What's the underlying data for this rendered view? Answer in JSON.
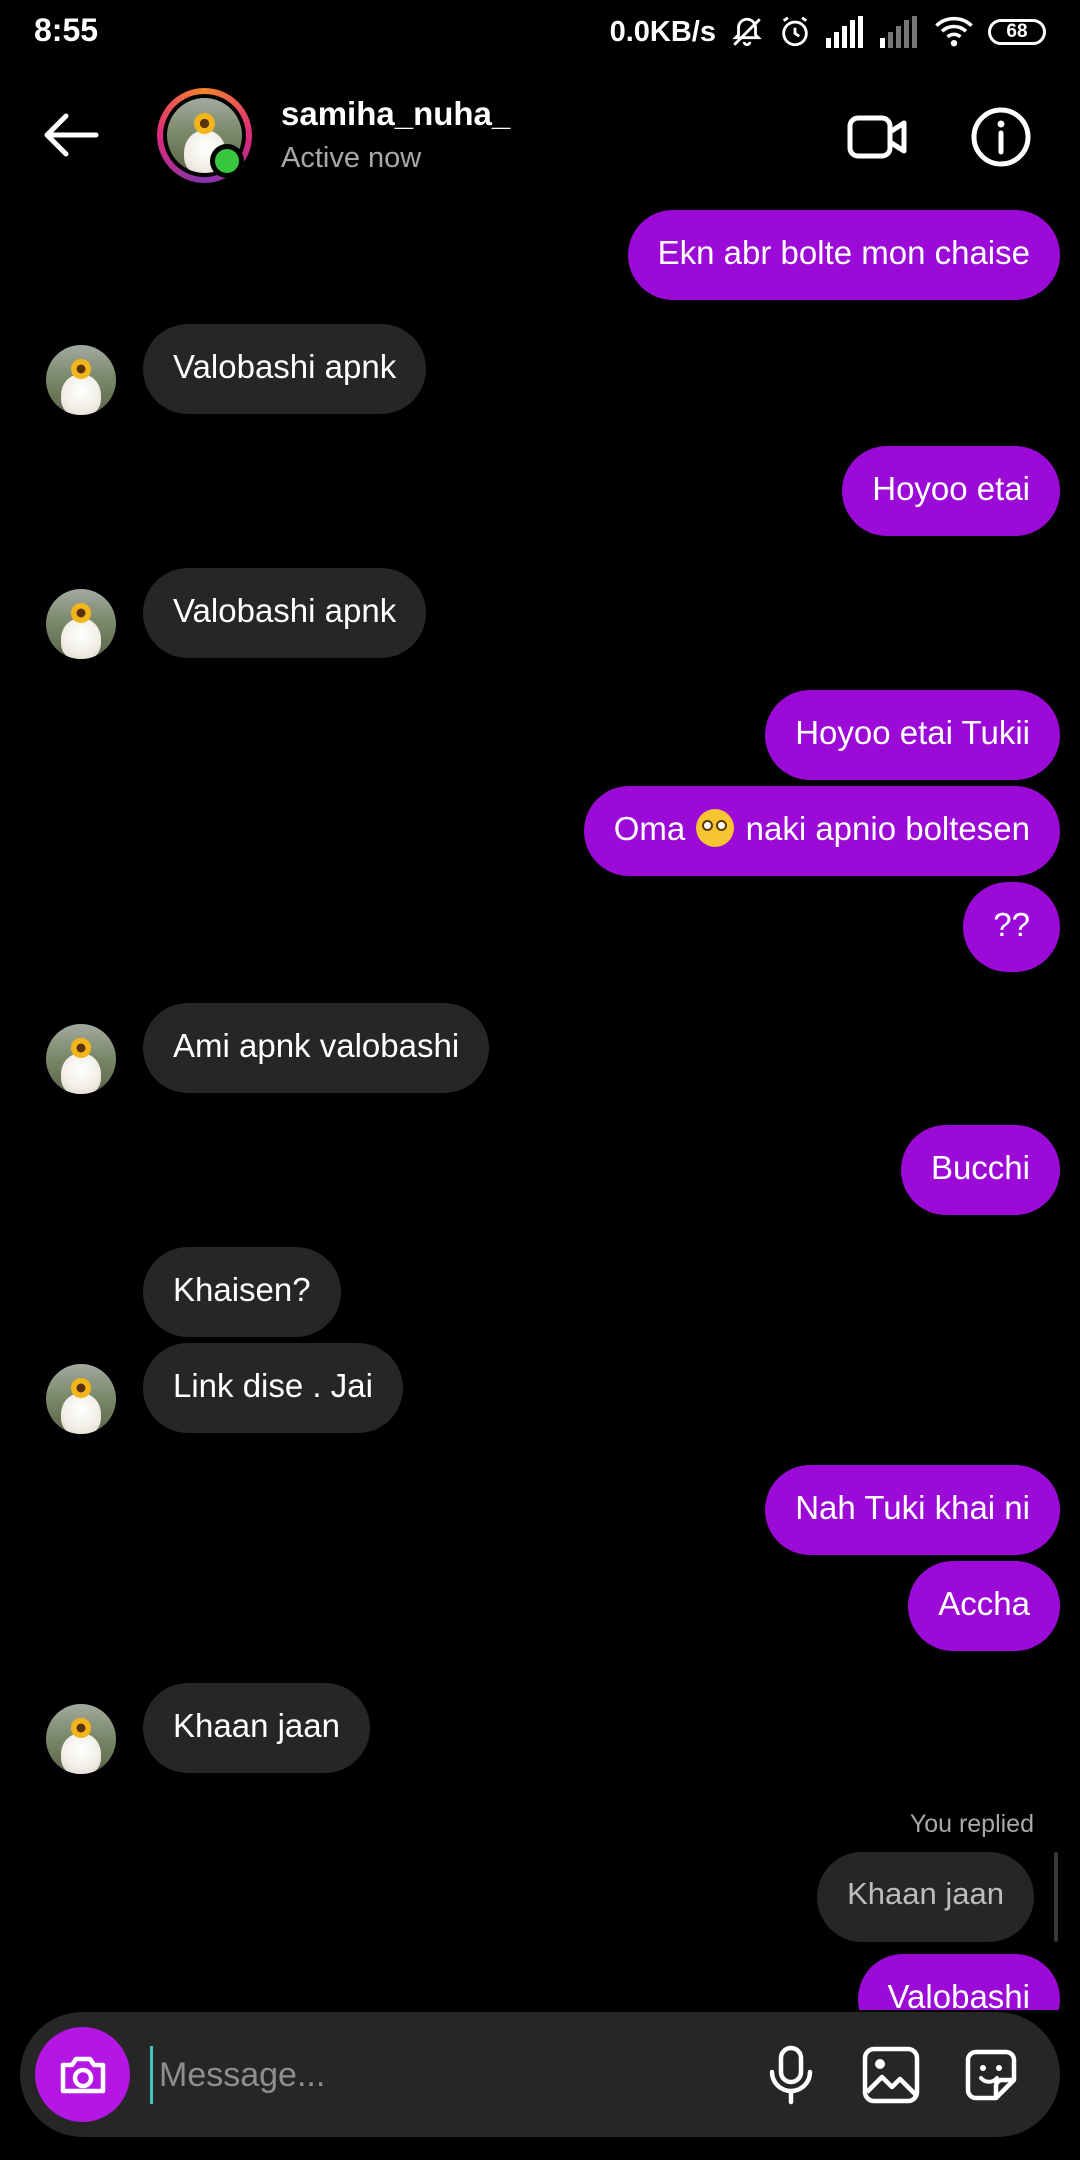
{
  "status_bar": {
    "time": "8:55",
    "net_speed": "0.0KB/s",
    "battery": "68"
  },
  "header": {
    "username": "samiha_nuha_",
    "presence": "Active now"
  },
  "messages": [
    {
      "dir": "out",
      "text": "Ekn abr bolte mon chaise"
    },
    {
      "dir": "in",
      "text": "Valobashi apnk"
    },
    {
      "dir": "out",
      "text": "Hoyoo etai"
    },
    {
      "dir": "in",
      "text": "Valobashi apnk"
    },
    {
      "dir": "out",
      "text": "Hoyoo etai Tukii"
    },
    {
      "dir": "out",
      "text_before": "Oma",
      "emoji": "face-with-rolling-eyes",
      "text_after": "naki apnio boltesen"
    },
    {
      "dir": "out",
      "text": "??"
    },
    {
      "dir": "in",
      "text": "Ami apnk valobashi"
    },
    {
      "dir": "out",
      "text": "Bucchi"
    },
    {
      "dir": "in",
      "text": "Khaisen?"
    },
    {
      "dir": "in",
      "text": "Link dise . Jai"
    },
    {
      "dir": "out",
      "text": "Nah Tuki khai ni"
    },
    {
      "dir": "out",
      "text": "Accha"
    },
    {
      "dir": "in",
      "text": "Khaan jaan"
    },
    {
      "dir": "out",
      "text": "Valobashi",
      "reply": {
        "label": "You replied",
        "quoted": "Khaan jaan"
      }
    }
  ],
  "composer": {
    "placeholder": "Message..."
  },
  "colors": {
    "outgoing_bubble": "#9b0ad6",
    "incoming_bubble": "#262626",
    "camera_button": "#b416e3",
    "active_dot": "#37c83f"
  }
}
